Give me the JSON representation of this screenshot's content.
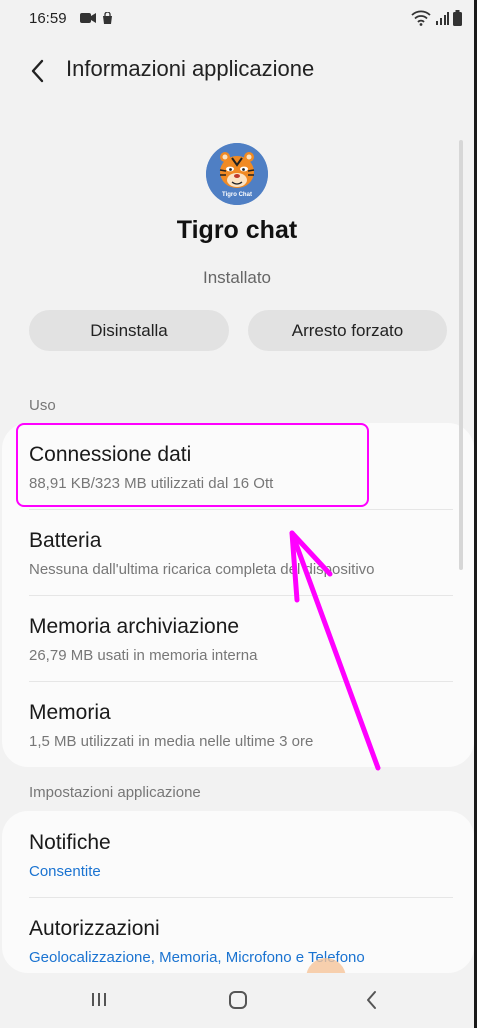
{
  "status_bar": {
    "time": "16:59"
  },
  "header": {
    "title": "Informazioni applicazione"
  },
  "app": {
    "name": "Tigro chat",
    "icon_caption": "Tigro Chat",
    "status": "Installato",
    "uninstall_label": "Disinstalla",
    "force_stop_label": "Arresto forzato"
  },
  "usage_section": {
    "label": "Uso",
    "items": [
      {
        "title": "Connessione dati",
        "subtitle": "88,91 KB/323 MB utilizzati dal 16 Ott"
      },
      {
        "title": "Batteria",
        "subtitle": "Nessuna dall'ultima ricarica completa del dispositivo"
      },
      {
        "title": "Memoria archiviazione",
        "subtitle": "26,79 MB usati in memoria interna"
      },
      {
        "title": "Memoria",
        "subtitle": "1,5 MB utilizzati in media nelle ultime 3 ore"
      }
    ]
  },
  "settings_section": {
    "label": "Impostazioni applicazione",
    "items": [
      {
        "title": "Notifiche",
        "subtitle": "Consentite"
      },
      {
        "title": "Autorizzazioni",
        "subtitle": "Geolocalizzazione, Memoria, Microfono e Telefono"
      }
    ]
  },
  "colors": {
    "highlight": "#ff00ff",
    "link_blue": "#1a73d1",
    "app_icon_bg": "#4f7fc4"
  }
}
